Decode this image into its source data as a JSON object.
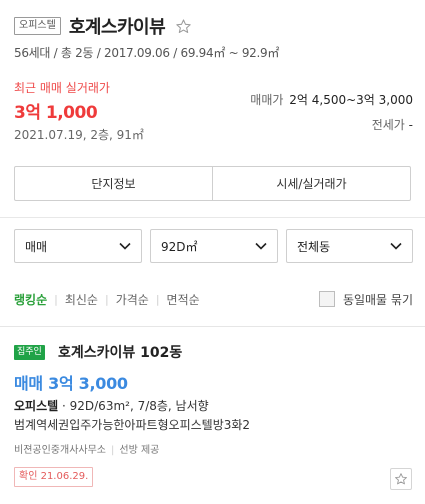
{
  "header": {
    "type_badge": "오피스텔",
    "title": "호계스카이뷰",
    "meta": "56세대 / 총 2동 / 2017.09.06 / 69.94㎡ ~ 92.9㎡"
  },
  "recent_trade": {
    "label": "최근 매매 실거래가",
    "price": "3억 1,000",
    "detail": "2021.07.19, 2층, 91㎡"
  },
  "price_summary": {
    "sale_label": "매매가",
    "sale_value": "2억 4,500~3억 3,000",
    "jeonse_label": "전세가",
    "jeonse_value": "-"
  },
  "tabs": {
    "complex_info": "단지정보",
    "market_price": "시세/실거래가"
  },
  "filters": {
    "trade_type": "매매",
    "area": "92D㎡",
    "building": "전체동"
  },
  "sort": {
    "items": [
      "랭킹순",
      "최신순",
      "가격순",
      "면적순"
    ],
    "active_index": 0,
    "group_label": "동일매물 묶기"
  },
  "listing": {
    "owner_badge": "집주인",
    "title": "호계스카이뷰 102동",
    "price": "매매 3억 3,000",
    "spec_type": "오피스텔",
    "spec_rest": "92D/63m², 7/8층, 남서향",
    "description": "범계역세권입주가능한아파트형오피스텔방3화2",
    "agent": "비젼공인중개사사무소",
    "provider": "선방 제공",
    "confirm": "확인 21.06.29."
  },
  "colors": {
    "accent_red": "#ef3b3b",
    "accent_green": "#2aa03a",
    "accent_blue": "#3b8ae0",
    "badge_green": "#20a347"
  }
}
